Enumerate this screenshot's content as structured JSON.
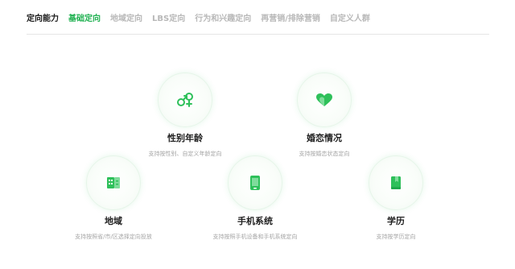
{
  "nav": {
    "title": "定向能力",
    "tabs": [
      {
        "label": "基础定向",
        "active": true
      },
      {
        "label": "地域定向",
        "active": false
      },
      {
        "label": "LBS定向",
        "active": false
      },
      {
        "label": "行为和兴趣定向",
        "active": false
      },
      {
        "label": "再营销/排除营销",
        "active": false
      },
      {
        "label": "自定义人群",
        "active": false
      }
    ]
  },
  "colors": {
    "accent": "#22b253",
    "icon_green": "#2ec05a",
    "tab_inactive": "#b8b8b8",
    "text_dark": "#1e1e1e",
    "text_muted": "#a4a4a4"
  },
  "cards": [
    {
      "icon": "gender-icon",
      "label": "性别年龄",
      "desc": "支持按性别、自定义年龄定向"
    },
    {
      "icon": "heart-icon",
      "label": "婚恋情况",
      "desc": "支持按婚恋状态定向"
    },
    {
      "icon": "map-icon",
      "label": "地域",
      "desc": "支持按照省/市/区选择定向投放"
    },
    {
      "icon": "phone-icon",
      "label": "手机系统",
      "desc": "支持按照手机设备和手机系统定向"
    },
    {
      "icon": "book-icon",
      "label": "学历",
      "desc": "支持按学历定向"
    }
  ]
}
